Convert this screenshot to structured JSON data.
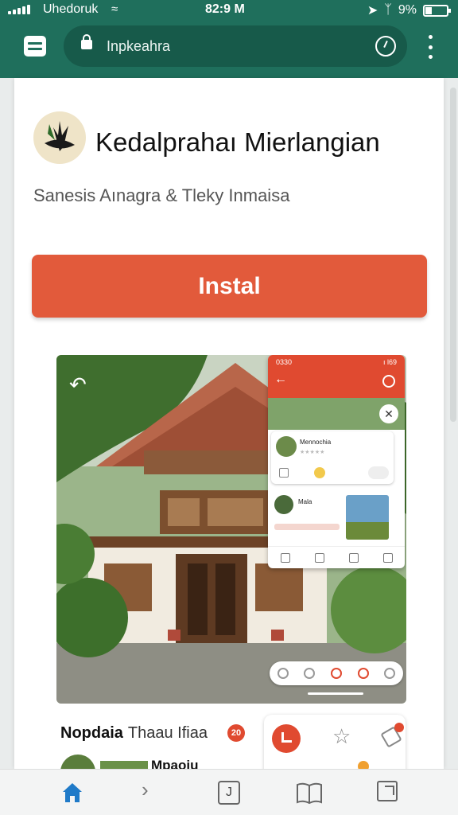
{
  "status_bar": {
    "carrier": "Uhedoruk",
    "time": "82:9 M",
    "battery": "9%"
  },
  "browser": {
    "url": "Inpkeahra"
  },
  "app": {
    "title": "Kedalprahaı Mierlangian",
    "subtitle": "Sanesis Aınagra & Tleky Inmaisa",
    "install_label": "Instal"
  },
  "preview": {
    "mock_status_left": "0330",
    "mock_status_right": "ı l69",
    "mock_chat_name": "Mennochia",
    "mock_user2": "Mala"
  },
  "section": {
    "title": "Nopdaia",
    "subtitle": "Thaau Ifiaa",
    "badge": "20",
    "reviewer": "Mpaoiu"
  },
  "colors": {
    "accent": "#e25a3b",
    "toolbar": "#1f6f5c",
    "home_icon": "#1f7ac8"
  },
  "icons": {
    "signal": "signal-bars-icon",
    "wifi": "wifi-icon",
    "location": "location-arrow-icon",
    "bluetooth": "bluetooth-icon",
    "battery": "battery-icon",
    "tabs": "tab-switcher-icon",
    "lock": "lock-icon",
    "reload": "reload-icon",
    "menu": "kebab-menu-icon",
    "home": "home-icon",
    "forward": "forward-icon",
    "bookmarks": "book-icon"
  }
}
